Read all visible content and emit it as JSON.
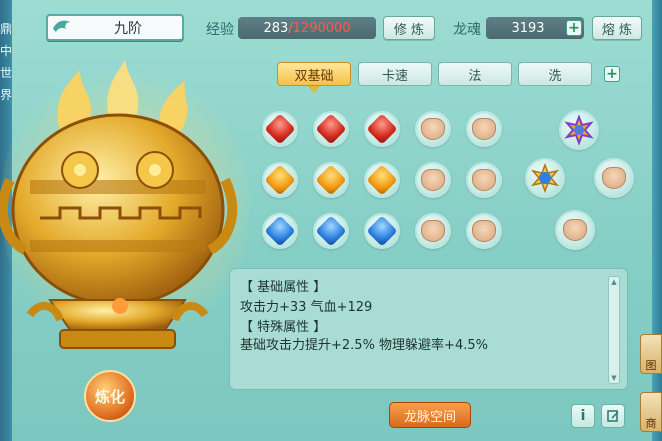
{
  "side_nav": {
    "chars": [
      "鼎",
      "中",
      "世",
      "界"
    ]
  },
  "header": {
    "tier_name": "九阶",
    "exp_label": "经验",
    "exp_current": "283",
    "exp_separator": "/",
    "exp_max": "1290000",
    "cultivate_btn": "修 炼",
    "soul_label": "龙魂",
    "soul_value": "3193",
    "melt_btn": "熔 炼",
    "plus": "+"
  },
  "tabs": [
    {
      "label": "双基础",
      "active": true
    },
    {
      "label": "卡速",
      "active": false
    },
    {
      "label": "法",
      "active": false
    },
    {
      "label": "洗",
      "active": false
    }
  ],
  "gem_grid": {
    "rows": [
      {
        "color": "red",
        "filled": 3,
        "empty": 2
      },
      {
        "color": "orange",
        "filled": 3,
        "empty": 2
      },
      {
        "color": "blue",
        "filled": 3,
        "empty": 2
      }
    ],
    "cluster": [
      "rainbow-gem-icon",
      "blue-gem-icon",
      "empty-socket",
      "empty-socket"
    ]
  },
  "stats": {
    "base_header": "【 基础属性 】",
    "base_line": "攻击力+33  气血+129",
    "special_header": "【 特殊属性 】",
    "special_line": "基础攻击力提升+2.5%  物理躲避率+4.5%"
  },
  "buttons": {
    "refine": "炼化",
    "dragon_vein_space": "龙脉空间",
    "info": "i"
  },
  "side_tabs": [
    "图",
    "商"
  ],
  "colors": {
    "accent": "#f3c24a",
    "exp_max": "#e23a2a",
    "panel_bg": "#a8dcd5"
  }
}
